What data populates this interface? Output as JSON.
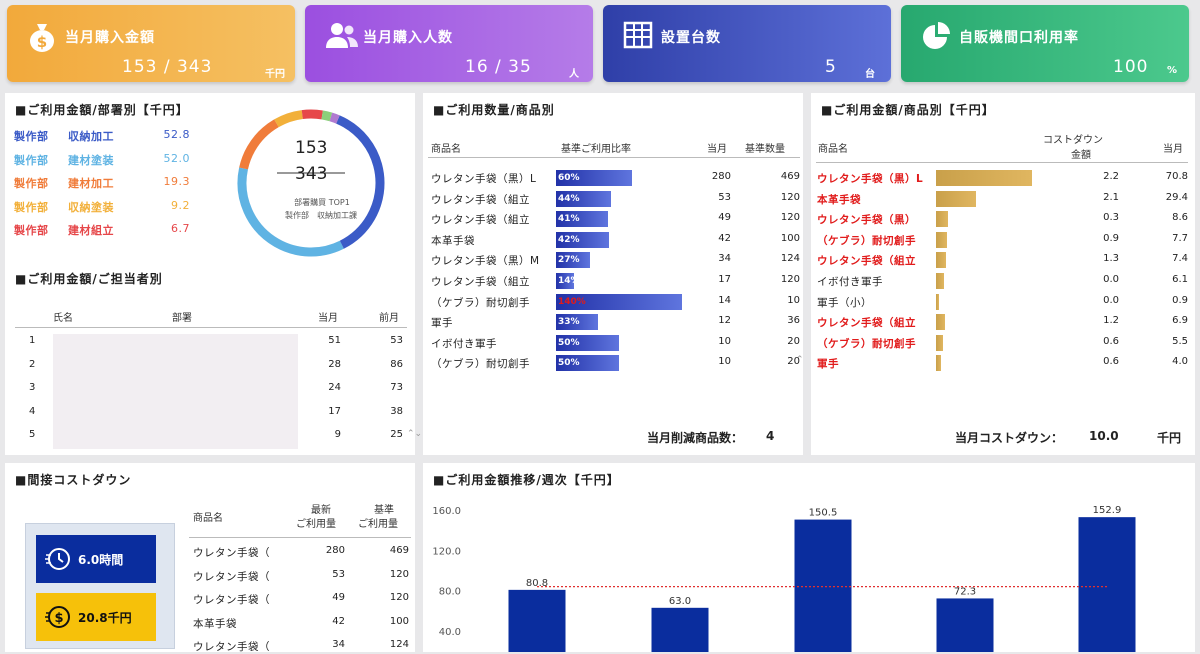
{
  "kpis": [
    {
      "title": "当月購入金額",
      "value": "153 / 343",
      "unit": "千円",
      "icon": "money-bag-icon",
      "color": "#f2a93b"
    },
    {
      "title": "当月購入人数",
      "value": "16 / 35",
      "unit": "人",
      "icon": "users-icon",
      "color": "#9b4fe0"
    },
    {
      "title": "設置台数",
      "value": "5",
      "unit": "台",
      "icon": "building-icon",
      "color": "#3446b0"
    },
    {
      "title": "自販機間口利用率",
      "value": "100",
      "unit": "%",
      "icon": "pie-icon",
      "color": "#2fb37a"
    }
  ],
  "dept": {
    "title": "■ご利用金額/部署別【千円】",
    "rows": [
      {
        "dept": "製作部",
        "name": "収納加工",
        "value": "52.8",
        "color": "#3b5bc7"
      },
      {
        "dept": "製作部",
        "name": "建材塗装",
        "value": "52.0",
        "color": "#5fb3e3"
      },
      {
        "dept": "製作部",
        "name": "建材加工",
        "value": "19.3",
        "color": "#f07c3a"
      },
      {
        "dept": "製作部",
        "name": "収納塗装",
        "value": "9.2",
        "color": "#f2b03a"
      },
      {
        "dept": "製作部",
        "name": "建材組立",
        "value": "6.7",
        "color": "#e6474a"
      }
    ],
    "donut": {
      "top": "153",
      "bottom": "343",
      "caption1": "部署購買 TOP1",
      "caption2": "製作部　収納加工課"
    }
  },
  "person": {
    "title": "■ご利用金額/ご担当者別",
    "headers": {
      "name": "氏名",
      "dept": "部署",
      "cur": "当月",
      "prev": "前月"
    },
    "rows": [
      {
        "no": "1",
        "cur": "51",
        "prev": "53"
      },
      {
        "no": "2",
        "cur": "28",
        "prev": "86"
      },
      {
        "no": "3",
        "cur": "24",
        "prev": "73"
      },
      {
        "no": "4",
        "cur": "17",
        "prev": "38"
      },
      {
        "no": "5",
        "cur": "9",
        "prev": "25"
      }
    ]
  },
  "qty": {
    "title": "■ご利用数量/商品別",
    "headers": {
      "name": "商品名",
      "ratio": "基準ご利用比率",
      "cur": "当月",
      "base": "基準数量"
    },
    "rows": [
      {
        "name": "ウレタン手袋（黒）L",
        "ratio": "60%",
        "pct": 60,
        "cur": "280",
        "base": "469"
      },
      {
        "name": "ウレタン手袋（組立",
        "ratio": "44%",
        "pct": 44,
        "cur": "53",
        "base": "120"
      },
      {
        "name": "ウレタン手袋（組立",
        "ratio": "41%",
        "pct": 41,
        "cur": "49",
        "base": "120"
      },
      {
        "name": "本革手袋",
        "ratio": "42%",
        "pct": 42,
        "cur": "42",
        "base": "100"
      },
      {
        "name": "ウレタン手袋（黒）M",
        "ratio": "27%",
        "pct": 27,
        "cur": "34",
        "base": "124"
      },
      {
        "name": "ウレタン手袋（組立",
        "ratio": "14%",
        "pct": 14,
        "cur": "17",
        "base": "120"
      },
      {
        "name": "（ケブラ）耐切創手",
        "ratio": "140%",
        "pct": 100,
        "cur": "14",
        "base": "10"
      },
      {
        "name": "軍手",
        "ratio": "33%",
        "pct": 33,
        "cur": "12",
        "base": "36"
      },
      {
        "name": "イボ付き軍手",
        "ratio": "50%",
        "pct": 50,
        "cur": "10",
        "base": "20"
      },
      {
        "name": "（ケブラ）耐切創手",
        "ratio": "50%",
        "pct": 50,
        "cur": "10",
        "base": "20"
      }
    ],
    "footer_label": "当月削減商品数：",
    "footer_value": "4"
  },
  "amount": {
    "title": "■ご利用金額/商品別【千円】",
    "headers": {
      "name": "商品名",
      "cost1": "コストダウン",
      "cost2": "金額",
      "cur": "当月"
    },
    "rows": [
      {
        "name": "ウレタン手袋（黒）L",
        "red": true,
        "cost": "2.2",
        "cur": "70.8",
        "frac": 1.0
      },
      {
        "name": "本革手袋",
        "red": true,
        "cost": "2.1",
        "cur": "29.4",
        "frac": 0.42
      },
      {
        "name": "ウレタン手袋（黒）",
        "red": true,
        "cost": "0.3",
        "cur": "8.6",
        "frac": 0.12
      },
      {
        "name": "（ケブラ）耐切創手",
        "red": true,
        "cost": "0.9",
        "cur": "7.7",
        "frac": 0.11
      },
      {
        "name": "ウレタン手袋（組立",
        "red": true,
        "cost": "1.3",
        "cur": "7.4",
        "frac": 0.105
      },
      {
        "name": "イボ付き軍手",
        "red": false,
        "cost": "0.0",
        "cur": "6.1",
        "frac": 0.086
      },
      {
        "name": "軍手（小）",
        "red": false,
        "cost": "0.0",
        "cur": "0.9",
        "frac": 0.0
      },
      {
        "name": "ウレタン手袋（組立",
        "red": true,
        "cost": "1.2",
        "cur": "6.9",
        "frac": 0.097
      },
      {
        "name": "（ケブラ）耐切創手",
        "red": true,
        "cost": "0.6",
        "cur": "5.5",
        "frac": 0.078
      },
      {
        "name": "軍手",
        "red": true,
        "cost": "0.6",
        "cur": "4.0",
        "frac": 0.056
      }
    ],
    "footer_label": "当月コストダウン：",
    "footer_value": "10.0",
    "footer_unit": "千円"
  },
  "indirect": {
    "title": "■間接コストダウン",
    "time": "6.0時間",
    "money": "20.8千円",
    "headers": {
      "name": "商品名",
      "latest1": "最新",
      "latest2": "ご利用量",
      "base1": "基準",
      "base2": "ご利用量"
    },
    "rows": [
      {
        "name": "ウレタン手袋（",
        "latest": "280",
        "base": "469"
      },
      {
        "name": "ウレタン手袋（",
        "latest": "53",
        "base": "120"
      },
      {
        "name": "ウレタン手袋（",
        "latest": "49",
        "base": "120"
      },
      {
        "name": "本革手袋",
        "latest": "42",
        "base": "100"
      },
      {
        "name": "ウレタン手袋（",
        "latest": "34",
        "base": "124"
      }
    ]
  },
  "weekly": {
    "title": "■ご利用金額推移/週次【千円】"
  },
  "chart_data": {
    "type": "bar",
    "title": "■ご利用金額推移/週次【千円】",
    "categories": [
      "",
      "",
      "",
      "",
      ""
    ],
    "values": [
      80.8,
      63.0,
      150.5,
      72.3,
      152.9
    ],
    "value_labels": [
      "80.8",
      "63.0",
      "150.5",
      "72.3",
      "152.9"
    ],
    "yticks": [
      "160.0",
      "120.0",
      "80.0",
      "40.0"
    ],
    "ytick_values": [
      160,
      120,
      80,
      40
    ],
    "ylim": [
      0,
      170
    ],
    "reference_line": 84,
    "bar_color": "#0a2d9e",
    "ref_color": "#e03030"
  }
}
